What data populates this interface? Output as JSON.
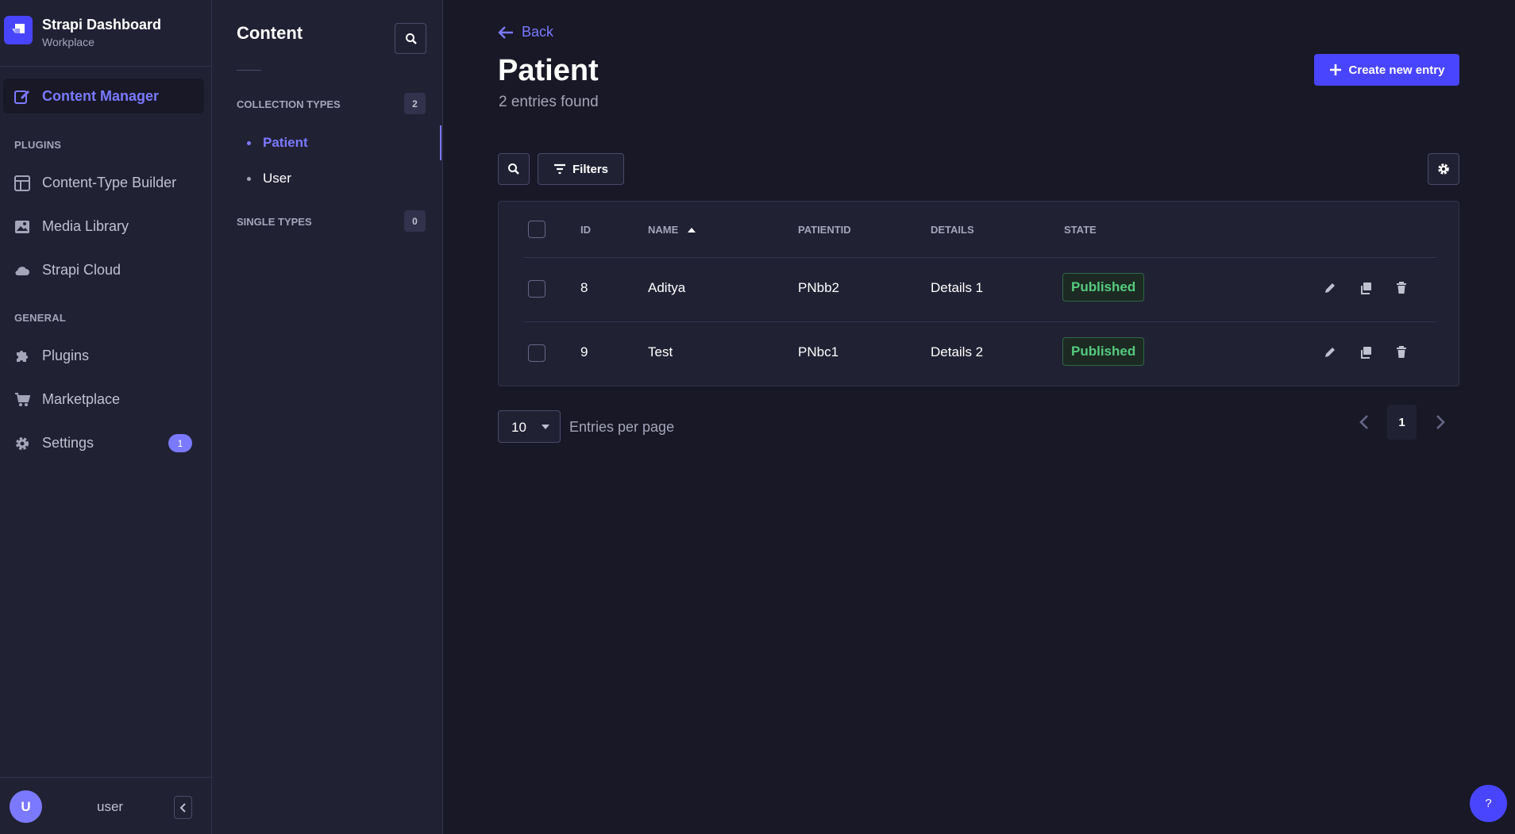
{
  "brand": {
    "title": "Strapi Dashboard",
    "subtitle": "Workplace"
  },
  "nav": {
    "content_manager": "Content Manager",
    "plugins_section": "PLUGINS",
    "content_type_builder": "Content-Type Builder",
    "media_library": "Media Library",
    "strapi_cloud": "Strapi Cloud",
    "general_section": "GENERAL",
    "plugins": "Plugins",
    "marketplace": "Marketplace",
    "settings": "Settings",
    "settings_badge": "1"
  },
  "footer": {
    "avatar_initial": "U",
    "username": "user"
  },
  "subnav": {
    "title": "Content",
    "collection_types": "COLLECTION TYPES",
    "collection_count": "2",
    "collection_items": [
      "Patient",
      "User"
    ],
    "single_types": "SINGLE TYPES",
    "single_count": "0"
  },
  "header": {
    "back_label": "Back",
    "title": "Patient",
    "subtitle": "2 entries found",
    "create_label": "Create new entry"
  },
  "toolbar": {
    "filters_label": "Filters"
  },
  "table": {
    "columns": [
      "ID",
      "NAME",
      "PATIENTID",
      "DETAILS",
      "STATE"
    ],
    "rows": [
      {
        "id": "8",
        "name": "Aditya",
        "patientid": "PNbb2",
        "details": "Details 1",
        "state": "Published"
      },
      {
        "id": "9",
        "name": "Test",
        "patientid": "PNbc1",
        "details": "Details 2",
        "state": "Published"
      }
    ]
  },
  "pagination": {
    "per_page_value": "10",
    "per_page_label": "Entries per page",
    "current_page": "1"
  },
  "help": {
    "label": "?"
  },
  "colors": {
    "primary": "#4945ff",
    "accent": "#7b79ff",
    "success": "#55cb7e",
    "background": "#181826",
    "surface": "#212134"
  }
}
